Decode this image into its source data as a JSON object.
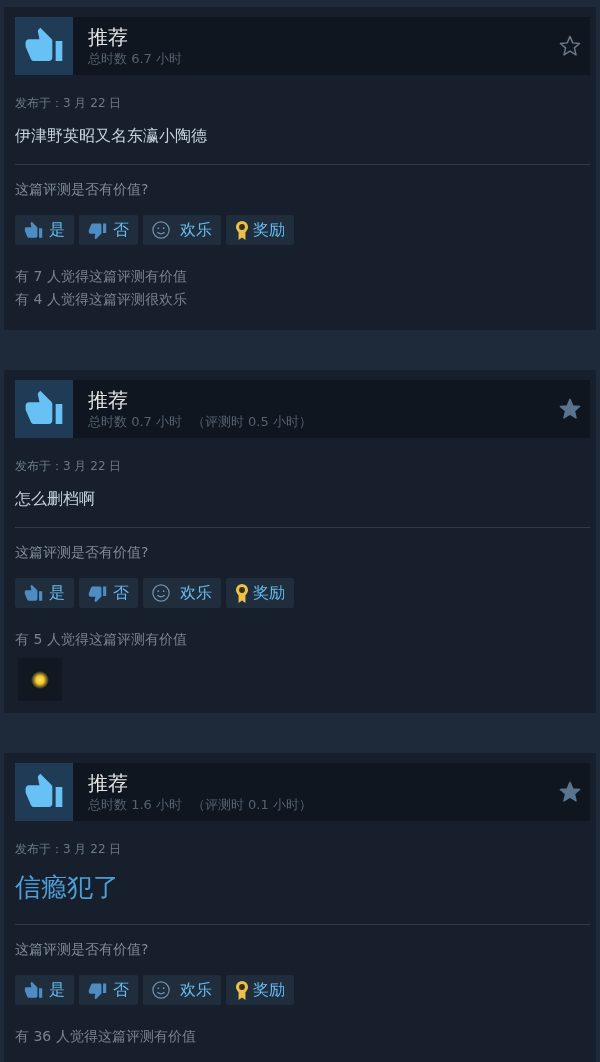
{
  "reviews": [
    {
      "recommended": true,
      "title": "推荐",
      "playtime": "总时数 6.7 小时",
      "starred": false,
      "date": "发布于：3 月 22 日",
      "body": {
        "kind": "plain",
        "text": "伊津野英昭又名东瀛小陶德"
      },
      "question": "这篇评测是否有价值?",
      "buttons": [
        {
          "kind": "yes",
          "label": "是"
        },
        {
          "kind": "no",
          "label": "否"
        },
        {
          "kind": "funny",
          "label": "欢乐"
        },
        {
          "kind": "award",
          "label": "奖励"
        }
      ],
      "counts": [
        "有 7 人觉得这篇评测有价值",
        "有 4 人觉得这篇评测很欢乐"
      ],
      "awarded": false
    },
    {
      "recommended": true,
      "title": "推荐",
      "playtime": "总时数 0.7 小时",
      "playtime_at_review": "（评测时 0.5 小时）",
      "starred": true,
      "date": "发布于：3 月 22 日",
      "body": {
        "kind": "plain",
        "text": "怎么删档啊"
      },
      "question": "这篇评测是否有价值?",
      "buttons": [
        {
          "kind": "yes",
          "label": "是"
        },
        {
          "kind": "no",
          "label": "否"
        },
        {
          "kind": "funny",
          "label": "欢乐"
        },
        {
          "kind": "award",
          "label": "奖励"
        }
      ],
      "counts": [
        "有 5 人觉得这篇评测有价值"
      ],
      "awarded": true
    },
    {
      "recommended": true,
      "title": "推荐",
      "playtime": "总时数 1.6 小时",
      "playtime_at_review": "（评测时 0.1 小时）",
      "starred": true,
      "date": "发布于：3 月 22 日",
      "body": {
        "kind": "heading",
        "text": "信瘾犯了"
      },
      "question": "这篇评测是否有价值?",
      "buttons": [
        {
          "kind": "yes",
          "label": "是"
        },
        {
          "kind": "no",
          "label": "否"
        },
        {
          "kind": "funny",
          "label": "欢乐"
        },
        {
          "kind": "award",
          "label": "奖励"
        }
      ],
      "counts": [
        "有 36 人觉得这篇评测有价值"
      ],
      "awarded": false
    }
  ]
}
